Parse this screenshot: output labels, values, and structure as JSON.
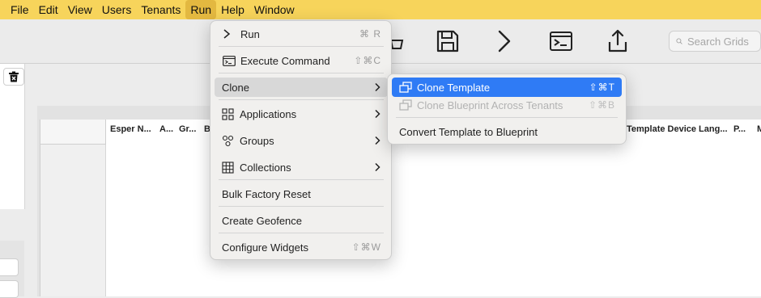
{
  "menubar": {
    "items": [
      {
        "label": "File"
      },
      {
        "label": "Edit"
      },
      {
        "label": "View"
      },
      {
        "label": "Users"
      },
      {
        "label": "Tenants"
      },
      {
        "label": "Run"
      },
      {
        "label": "Help"
      },
      {
        "label": "Window"
      }
    ]
  },
  "toolbar": {
    "search_placeholder": "Search Grids"
  },
  "grid": {
    "columns": [
      "Esper N...",
      "A...",
      "Gr...",
      "B",
      "Template Device Lang...",
      "P...",
      "M"
    ]
  },
  "run_menu": {
    "items": [
      {
        "label": "Run",
        "shortcut": "⌘ R"
      },
      {
        "label": "Execute Command",
        "shortcut": "⇧⌘C"
      },
      {
        "label": "Clone"
      },
      {
        "label": "Applications"
      },
      {
        "label": "Groups"
      },
      {
        "label": "Collections"
      },
      {
        "label": "Bulk Factory Reset"
      },
      {
        "label": "Create Geofence"
      },
      {
        "label": "Configure Widgets",
        "shortcut": "⇧⌘W"
      }
    ]
  },
  "clone_submenu": {
    "items": [
      {
        "label": "Clone Template",
        "shortcut": "⇧⌘T"
      },
      {
        "label": "Clone Blueprint Across Tenants",
        "shortcut": "⇧⌘B"
      },
      {
        "label": "Convert Template to Blueprint"
      }
    ]
  },
  "colors": {
    "menubar": "#f7d45b",
    "selection": "#2f7bf5"
  }
}
